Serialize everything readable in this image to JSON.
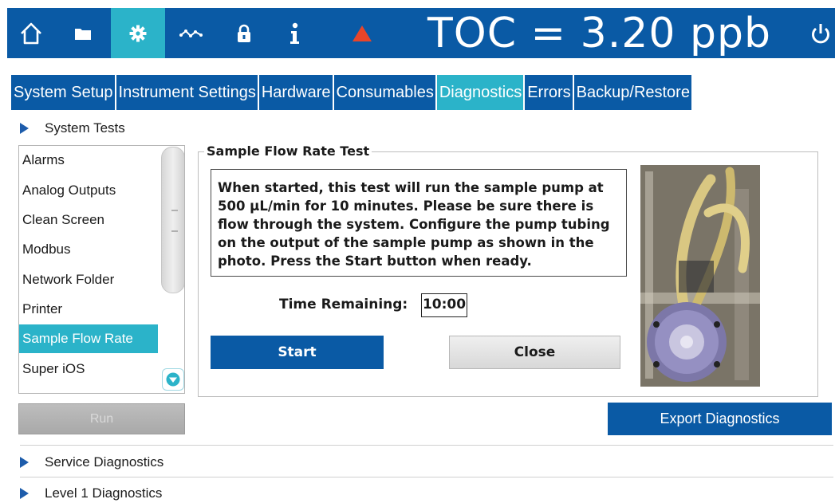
{
  "header": {
    "toc_readout": "TOC = 3.20 ppb",
    "icons": [
      "home-icon",
      "folder-icon",
      "gear-icon",
      "trend-icon",
      "lock-icon",
      "info-icon",
      "alarm-triangle-icon",
      "power-icon"
    ],
    "active_icon": "gear-icon",
    "alarm_color": "#e8452a"
  },
  "tabs": [
    {
      "label": "System Setup"
    },
    {
      "label": "Instrument Settings"
    },
    {
      "label": "Hardware"
    },
    {
      "label": "Consumables"
    },
    {
      "label": "Diagnostics",
      "active": true
    },
    {
      "label": "Errors"
    },
    {
      "label": "Backup/Restore"
    }
  ],
  "sections": {
    "system_tests": "System Tests",
    "service_diagnostics": "Service Diagnostics",
    "level1_diagnostics": "Level 1 Diagnostics"
  },
  "test_list": {
    "items": [
      "Alarms",
      "Analog Outputs",
      "Clean Screen",
      "Modbus",
      "Network Folder",
      "Printer",
      "Sample Flow Rate",
      "Super iOS"
    ],
    "selected": "Sample Flow Rate"
  },
  "test": {
    "title": "Sample Flow Rate Test",
    "instructions": "When started, this test will run the sample pump at 500 µL/min for 10 minutes. Please be sure there is flow through the system. Configure the pump tubing on the output of the sample pump as shown in the photo. Press the Start button when ready.",
    "time_label": "Time Remaining:",
    "time_value": "10:00",
    "start_label": "Start",
    "close_label": "Close"
  },
  "buttons": {
    "run_label": "Run",
    "export_label": "Export Diagnostics"
  },
  "colors": {
    "primary": "#0a5aa5",
    "accent": "#2bb3c9"
  }
}
